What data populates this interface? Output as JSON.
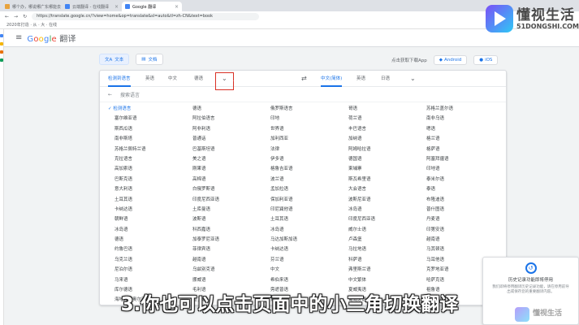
{
  "tabs": [
    {
      "label": "哪个办，哪说哪广东哪能去",
      "color": "#e8a33d"
    },
    {
      "label": "云端翻译 - 在线翻译",
      "color": "#4285f4"
    },
    {
      "label": "Google 翻译",
      "color": "#4285f4"
    }
  ],
  "address": {
    "url": "https://translate.google.cn/?view=home&op=translate&sl=auto&tl=zh-CN&text=book"
  },
  "bookmarks": {
    "label": "2020年打造 · 从 · 大 · 在线"
  },
  "header": {
    "title": "Google 翻译",
    "menu_icon": "hamburger-icon"
  },
  "modes": [
    {
      "label": "文本",
      "icon": "text-icon"
    },
    {
      "label": "文档",
      "icon": "document-icon"
    }
  ],
  "app": {
    "prompt": "点击获取下载App",
    "android": "Android",
    "ios": "iOS"
  },
  "langbar": {
    "source": [
      "检测到语言",
      "英语",
      "中文",
      "德语"
    ],
    "swap_icon": "swap-icon",
    "target": [
      "中文(简体)",
      "英语",
      "日语"
    ],
    "more_icon": "chevron-down-icon"
  },
  "search": {
    "placeholder": "搜索语言"
  },
  "languages": [
    "检测语言",
    "德语",
    "俄罗斯语言",
    "哥语",
    "苏格兰盖尔语",
    "塞尔维亚语",
    "阿拉伯语言",
    "印地",
    "荷兰语",
    "南非乌语",
    "斯西瓜语",
    "阿非利语",
    "世界语",
    "丰巴语言",
    "嗯语",
    "南非斯塔",
    "普通话",
    "加利西亚",
    "加纳语",
    "格兰语",
    "苏格兰佩特兰语",
    "巴基斯坦语",
    "法律",
    "阿姆哈拉语",
    "格萨语",
    "克拉语言",
    "美之语",
    "伊多语",
    "德国语",
    "阿塞拜疆语",
    "高加索语",
    "刚果语",
    "格鲁吉亚语",
    "柬埔寨",
    "印地语",
    "巴斯克语",
    "高棉语",
    "波兰语",
    "斯瓦希里语",
    "泰米尔语",
    "意大利语",
    "白俄罗斯语",
    "孟加拉语",
    "大会语言",
    "泰语",
    "土耳其语",
    "印度尼西亚语",
    "保加利亚语",
    "波斯尼亚语",
    "布隆迪语",
    "卡纳达语",
    "土库曼语",
    "印尼巽他语",
    "冰岛语",
    "普什图语",
    "朝鲜语",
    "波斯语",
    "土耳其语",
    "印度尼西亚语",
    "丹麦语",
    "冰岛语",
    "科西嘉语",
    "冰岛语",
    "威尔士语",
    "印第安语",
    "德语",
    "加泰罗尼亚语",
    "马达加斯加语",
    "卢森堡",
    "越南语",
    "约鲁巴语",
    "菲律宾语",
    "卡纳达语",
    "马拉地语",
    "马其顿语",
    "乌克兰语",
    "越南语",
    "芬兰语",
    "科萨语",
    "马耳他语",
    "尼泊尔语",
    "乌兹别克语",
    "中文",
    "弗里斯兰语",
    "克罗地亚语",
    "马来语",
    "挪威语",
    "希伯来语",
    "中文繁体",
    "哈萨克语",
    "库尔德语",
    "毛利语",
    "旁遮普语",
    "夏威夷语",
    "祖鲁语",
    "海地克里奥尔语",
    "拉丁语",
    "蒙古语",
    "葡萄牙语",
    "匈牙利语",
    "",
    "豪萨语",
    "拉脱维亚语",
    "缅甸语",
    "齐切瓦语",
    "亚美尼亚语",
    "",
    "韩语",
    "老挝语",
    "苗语",
    "日语",
    "伊博语",
    ""
  ],
  "history": {
    "title": "历史记录功能即将停用",
    "body": "我们即将停用翻译历史记录功能，请在停用前导出或保存您的重要翻译内容。",
    "icon": "history-icon"
  },
  "watermark": {
    "zh": "懂视生活",
    "en": "51DONGSHI.COM"
  },
  "subtitle": "3.你也可以点击页面中的小三角切换翻译"
}
